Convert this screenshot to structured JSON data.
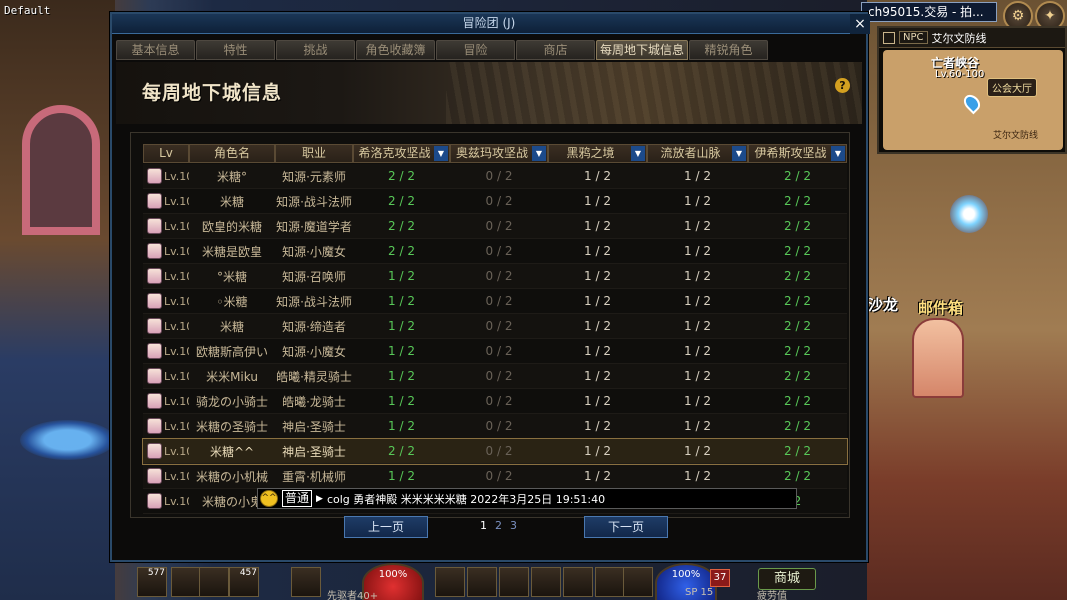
{
  "corner_label": "Default",
  "channel": {
    "text": "ch95015.交易 - 拍..."
  },
  "minimap": {
    "npc_tag": "NPC",
    "area_name": "艾尔文防线",
    "zone_title": "亡者峡谷",
    "zone_level": "Lv.60-100",
    "guild_label": "公会大厅",
    "defense_label": "艾尔文防线"
  },
  "scene": {
    "mailbox_label": "邮件箱",
    "salon_label": "沙龙"
  },
  "window": {
    "title": "冒险团 (J)",
    "close_label": "×",
    "tabs": [
      {
        "label": "基本信息",
        "active": false
      },
      {
        "label": "特性",
        "active": false
      },
      {
        "label": "挑战",
        "active": false
      },
      {
        "label": "角色收藏簿",
        "active": false
      },
      {
        "label": "冒险",
        "active": false
      },
      {
        "label": "商店",
        "active": false
      },
      {
        "label": "每周地下城信息",
        "active": true
      },
      {
        "label": "精锐角色",
        "active": false
      }
    ],
    "banner_title": "每周地下城信息",
    "help_label": "?"
  },
  "table": {
    "headers": {
      "lv": "Lv",
      "name": "角色名",
      "job": "职业",
      "dungeons": [
        "希洛克攻坚战",
        "奥兹玛攻坚战",
        "黑鸦之境",
        "流放者山脉",
        "伊希斯攻坚战"
      ]
    },
    "dropdown_glyph": "▼",
    "rows": [
      {
        "lv": "Lv.100",
        "name": "米糖°",
        "job": "知源·元素师",
        "d": [
          "2 / 2",
          "0 / 2",
          "1 / 2",
          "1 / 2",
          "2 / 2"
        ]
      },
      {
        "lv": "Lv.100",
        "name": "米糖",
        "job": "知源·战斗法师",
        "d": [
          "2 / 2",
          "0 / 2",
          "1 / 2",
          "1 / 2",
          "2 / 2"
        ]
      },
      {
        "lv": "Lv.100",
        "name": "欧皇的米糖",
        "job": "知源·魔道学者",
        "d": [
          "2 / 2",
          "0 / 2",
          "1 / 2",
          "1 / 2",
          "2 / 2"
        ]
      },
      {
        "lv": "Lv.100",
        "name": "米糖是欧皇",
        "job": "知源·小魔女",
        "d": [
          "2 / 2",
          "0 / 2",
          "1 / 2",
          "1 / 2",
          "2 / 2"
        ]
      },
      {
        "lv": "Lv.100",
        "name": "°米糖",
        "job": "知源·召唤师",
        "d": [
          "1 / 2",
          "0 / 2",
          "1 / 2",
          "1 / 2",
          "2 / 2"
        ]
      },
      {
        "lv": "Lv.100",
        "name": "◦米糖",
        "job": "知源·战斗法师",
        "d": [
          "1 / 2",
          "0 / 2",
          "1 / 2",
          "1 / 2",
          "2 / 2"
        ]
      },
      {
        "lv": "Lv.100",
        "name": "米糖",
        "job": "知源·缔造者",
        "d": [
          "1 / 2",
          "0 / 2",
          "1 / 2",
          "1 / 2",
          "2 / 2"
        ]
      },
      {
        "lv": "Lv.100",
        "name": "欧糖斯高伊い",
        "job": "知源·小魔女",
        "d": [
          "1 / 2",
          "0 / 2",
          "1 / 2",
          "1 / 2",
          "2 / 2"
        ]
      },
      {
        "lv": "Lv.100",
        "name": "米米Miku",
        "job": "皓曦·精灵骑士",
        "d": [
          "1 / 2",
          "0 / 2",
          "1 / 2",
          "1 / 2",
          "2 / 2"
        ]
      },
      {
        "lv": "Lv.100",
        "name": "骑龙の小骑士",
        "job": "皓曦·龙骑士",
        "d": [
          "1 / 2",
          "0 / 2",
          "1 / 2",
          "1 / 2",
          "2 / 2"
        ]
      },
      {
        "lv": "Lv.100",
        "name": "米糖の圣骑士",
        "job": "神启·圣骑士",
        "d": [
          "1 / 2",
          "0 / 2",
          "1 / 2",
          "1 / 2",
          "2 / 2"
        ]
      },
      {
        "lv": "Lv.100",
        "name": "米糖^^",
        "job": "神启·圣骑士",
        "d": [
          "2 / 2",
          "0 / 2",
          "1 / 2",
          "1 / 2",
          "2 / 2"
        ],
        "selected": true
      },
      {
        "lv": "Lv.100",
        "name": "米糖の小机械",
        "job": "重霄·机械师",
        "d": [
          "1 / 2",
          "0 / 2",
          "1 / 2",
          "1 / 2",
          "2 / 2"
        ]
      },
      {
        "lv": "Lv.100",
        "name": "米糖の小鬼",
        "job": "",
        "d": [
          "",
          "",
          "",
          "",
          "2"
        ]
      }
    ]
  },
  "pager": {
    "prev_label": "上一页",
    "next_label": "下一页",
    "pages": [
      "1",
      "2",
      "3"
    ],
    "current_page": "1"
  },
  "chat": {
    "emoji": "^^",
    "channel_label": "普通",
    "arrow": "▶",
    "message": "colg 勇者神殿 米米米米米糖 2022年3月25日 19:51:40"
  },
  "hotbar": {
    "slot_counts": [
      "577",
      "",
      "",
      "457",
      ""
    ],
    "hp_label": "100%",
    "mp_label": "100%",
    "level_badge": "37",
    "town_label": "商城",
    "left_status": "先驱者40+",
    "sp_label": "SP 15",
    "fatigue_label": "疲劳值"
  }
}
